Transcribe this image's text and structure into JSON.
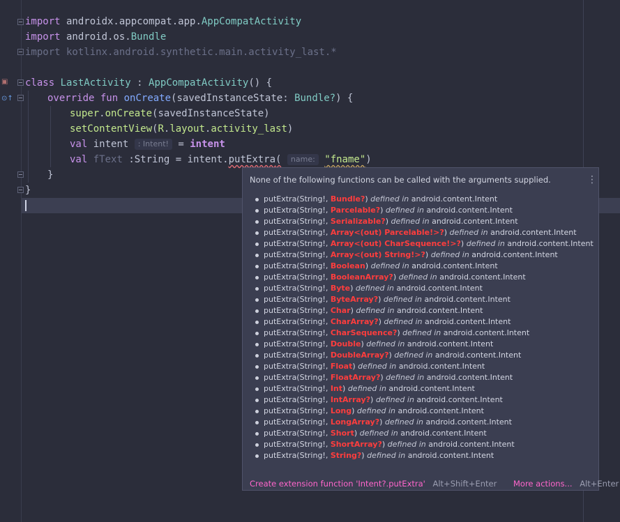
{
  "editor": {
    "lines": {
      "l1": {
        "kw": "import",
        "text": " androidx.appcompat.app.",
        "cls": "AppCompatActivity"
      },
      "l2": {
        "kw": "import",
        "text": " android.os.",
        "cls": "Bundle"
      },
      "l3": {
        "text": "import kotlinx.android.synthetic.main.activity_last.*"
      },
      "l5": {
        "kw": "class",
        "name": "LastActivity",
        "sep": " : ",
        "parent": "AppCompatActivity",
        "rest": "() {"
      },
      "l6": {
        "kw1": "override",
        "kw2": "fun",
        "fn": "onCreate",
        "p1": "(savedInstanceState: ",
        "ty": "Bundle?",
        "rest": ") {"
      },
      "l7": {
        "kw": "super",
        "dot": ".",
        "fn": "onCreate",
        "rest": "(savedInstanceState)"
      },
      "l8": {
        "fn": "setContentView",
        "open": "(",
        "r": "R",
        "dot1": ".",
        "layout": "layout",
        "dot2": ".",
        "res": "activity_last",
        "close": ")"
      },
      "l9": {
        "kw": "val",
        "name": " intent ",
        "hint": ": Intent!",
        "eq": " = ",
        "value": "intent"
      },
      "l10": {
        "kw": "val",
        "name": "fText",
        "type": " :String = intent.",
        "call": "putExtra",
        "open": "(",
        "hint": "name:",
        "arg": "\"fname\"",
        "close": ")"
      },
      "l11": {
        "text": "}"
      },
      "l12": {
        "text": "}"
      }
    }
  },
  "popup": {
    "title": "None of the following functions can be called with the arguments supplied.",
    "menu_glyph": "⋮",
    "prefix": "putExtra(String!, ",
    "defined_in": "defined in",
    "package": "android.content.Intent",
    "overloads": [
      "Bundle?",
      "Parcelable?",
      "Serializable?",
      "Array<(out) Parcelable!>?",
      "Array<(out) CharSequence!>?",
      "Array<(out) String!>?",
      "Boolean",
      "BooleanArray?",
      "Byte",
      "ByteArray?",
      "Char",
      "CharArray?",
      "CharSequence?",
      "Double",
      "DoubleArray?",
      "Float",
      "FloatArray?",
      "Int",
      "IntArray?",
      "Long",
      "LongArray?",
      "Short",
      "ShortArray?",
      "String?"
    ],
    "footer": {
      "create_label": "Create extension function 'Intent?.putExtra'",
      "create_shortcut": "Alt+Shift+Enter",
      "more_label": "More actions...",
      "more_shortcut": "Alt+Enter"
    }
  }
}
